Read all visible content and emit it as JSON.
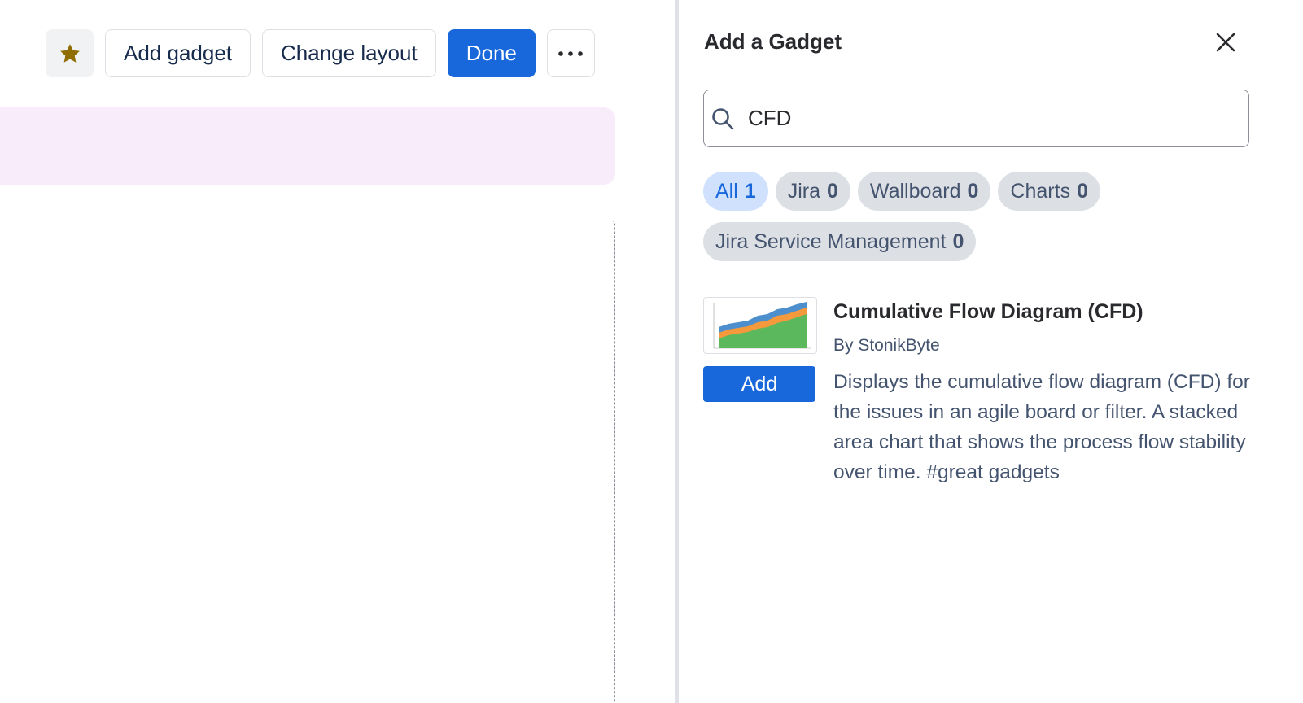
{
  "toolbar": {
    "star_icon": "star-icon",
    "star_color": "#8f6d00",
    "add_gadget_label": "Add gadget",
    "change_layout_label": "Change layout",
    "done_label": "Done",
    "more_icon": "more-horizontal-icon"
  },
  "panel": {
    "title": "Add a Gadget",
    "close_icon": "close-icon",
    "search": {
      "value": "CFD",
      "icon": "search-icon"
    },
    "filters": [
      {
        "label": "All",
        "count": "1",
        "active": true
      },
      {
        "label": "Jira",
        "count": "0",
        "active": false
      },
      {
        "label": "Wallboard",
        "count": "0",
        "active": false
      },
      {
        "label": "Charts",
        "count": "0",
        "active": false
      },
      {
        "label": "Jira Service Management",
        "count": "0",
        "active": false
      }
    ],
    "results": [
      {
        "title": "Cumulative Flow Diagram (CFD)",
        "author": "By StonikByte",
        "description": "Displays the cumulative flow diagram (CFD) for the issues in an agile board or filter. A stacked area chart that shows the process flow stability over time. #great gadgets",
        "add_label": "Add",
        "thumbnail": "cfd-chart-thumbnail"
      }
    ]
  },
  "colors": {
    "primary": "#1868db",
    "banner": "#f8ecfb",
    "chip_active_bg": "#cfe1fd",
    "chip_bg": "#dcdfe4"
  }
}
